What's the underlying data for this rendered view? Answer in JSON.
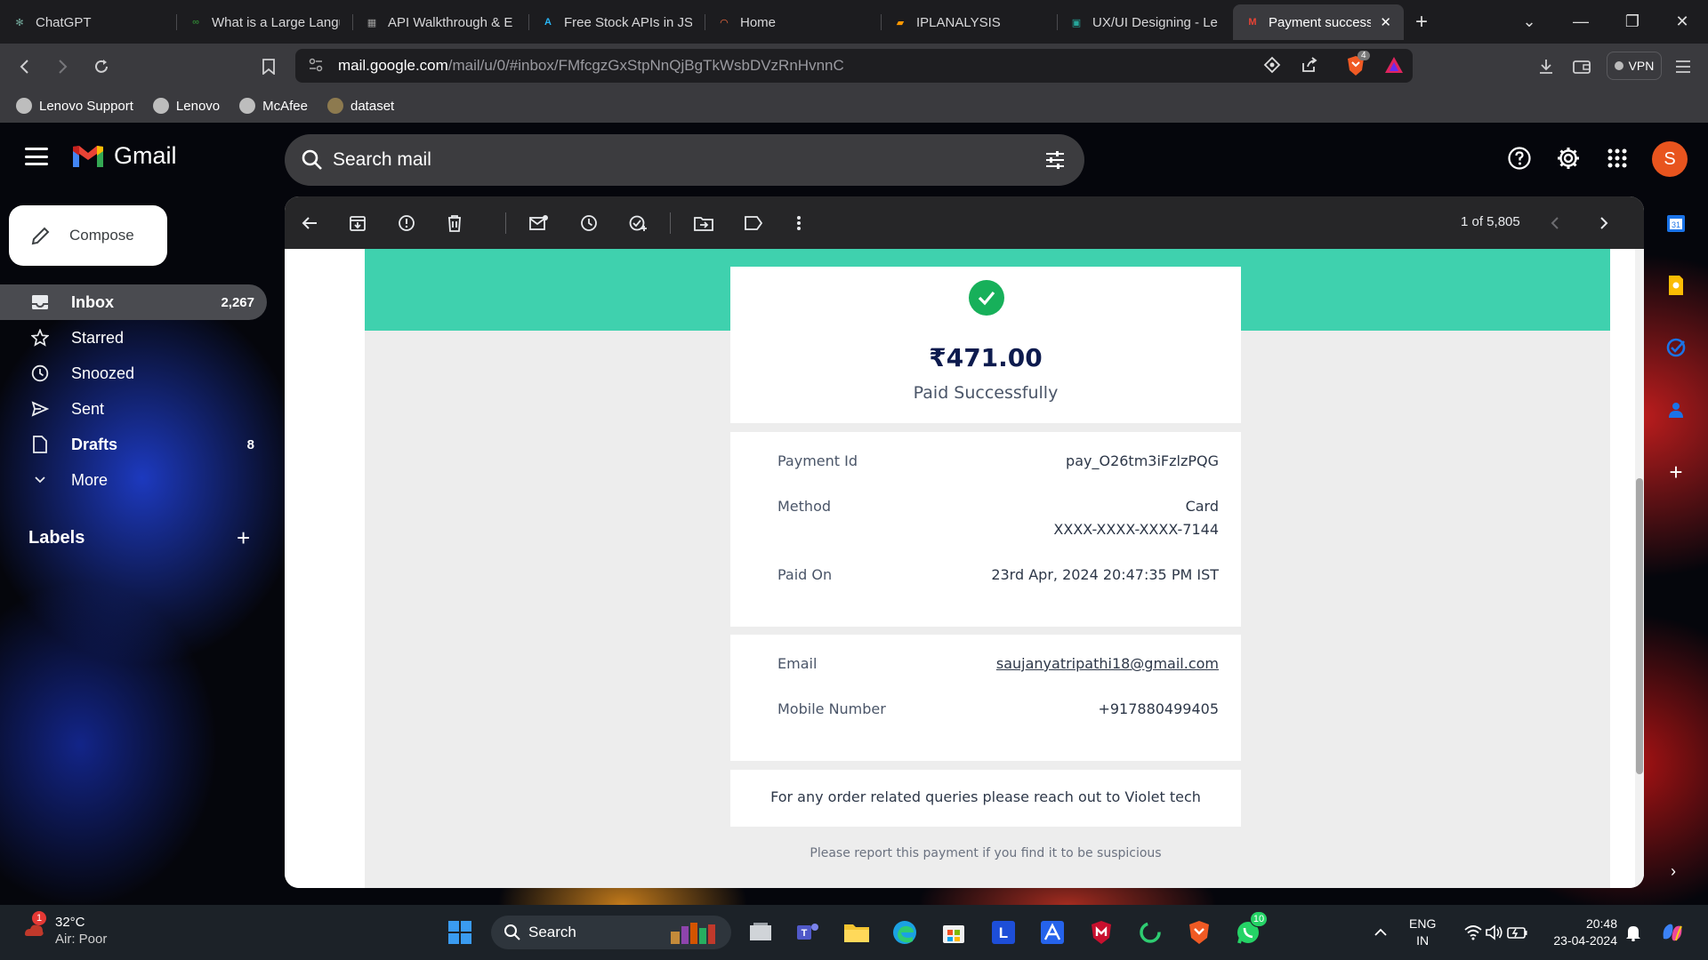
{
  "browser": {
    "tabs": [
      {
        "label": "ChatGPT",
        "favicon_color": "#74aa9c",
        "favicon_glyph": "✻"
      },
      {
        "label": "What is a Large Langu",
        "favicon_color": "#2e7d32",
        "favicon_glyph": "∞"
      },
      {
        "label": "API Walkthrough & E",
        "favicon_color": "#9e9e9e",
        "favicon_glyph": "▦"
      },
      {
        "label": "Free Stock APIs in JSO",
        "favicon_color": "#29b6f6",
        "favicon_glyph": "A"
      },
      {
        "label": "Home",
        "favicon_color": "#ff7043",
        "favicon_glyph": "◠"
      },
      {
        "label": "IPLANALYSIS",
        "favicon_color": "#ff9800",
        "favicon_glyph": "▰"
      },
      {
        "label": "UX/UI Designing - Le",
        "favicon_color": "#26a69a",
        "favicon_glyph": "▣"
      },
      {
        "label": "Payment success",
        "favicon_color": "#ea4335",
        "favicon_glyph": "M",
        "active": true
      }
    ],
    "url_host": "mail.google.com",
    "url_path": "/mail/u/0/#inbox/FMfcgzGxStpNnQjBgTkWsbDVzRnHvnnC",
    "vpn_label": "VPN",
    "shield_count": "4",
    "bookmarks": [
      "Lenovo Support",
      "Lenovo",
      "McAfee",
      "dataset"
    ]
  },
  "gmail": {
    "logo_text": "Gmail",
    "search_placeholder": "Search mail",
    "avatar_letter": "S",
    "compose_label": "Compose",
    "nav": [
      {
        "label": "Inbox",
        "count": "2,267",
        "icon": "inbox-icon"
      },
      {
        "label": "Starred",
        "count": "",
        "icon": "star-icon"
      },
      {
        "label": "Snoozed",
        "count": "",
        "icon": "clock-icon"
      },
      {
        "label": "Sent",
        "count": "",
        "icon": "send-icon"
      },
      {
        "label": "Drafts",
        "count": "8",
        "icon": "draft-icon"
      },
      {
        "label": "More",
        "count": "",
        "icon": "chevron-down-icon"
      }
    ],
    "labels_heading": "Labels",
    "pager": "1 of 5,805"
  },
  "receipt": {
    "amount": "₹471.00",
    "status": "Paid Successfully",
    "payment_id_label": "Payment Id",
    "payment_id": "pay_O26tm3iFzlzPQG",
    "method_label": "Method",
    "method": "Card",
    "card_number": "XXXX-XXXX-XXXX-7144",
    "paid_on_label": "Paid On",
    "paid_on": "23rd Apr, 2024 20:47:35 PM IST",
    "email_label": "Email",
    "email": "saujanyatripathi18@gmail.com",
    "mobile_label": "Mobile Number",
    "mobile": "+917880499405",
    "query_text": "For any order related queries please reach out to Violet tech",
    "report_text": "Please report this payment if you find it to be suspicious",
    "accent_color": "#3fd1ae"
  },
  "taskbar": {
    "temperature": "32°C",
    "air_quality": "Air: Poor",
    "weather_badge": "1",
    "search_label": "Search",
    "whatsapp_badge": "10",
    "lang_line1": "ENG",
    "lang_line2": "IN",
    "time": "20:48",
    "date": "23-04-2024"
  }
}
